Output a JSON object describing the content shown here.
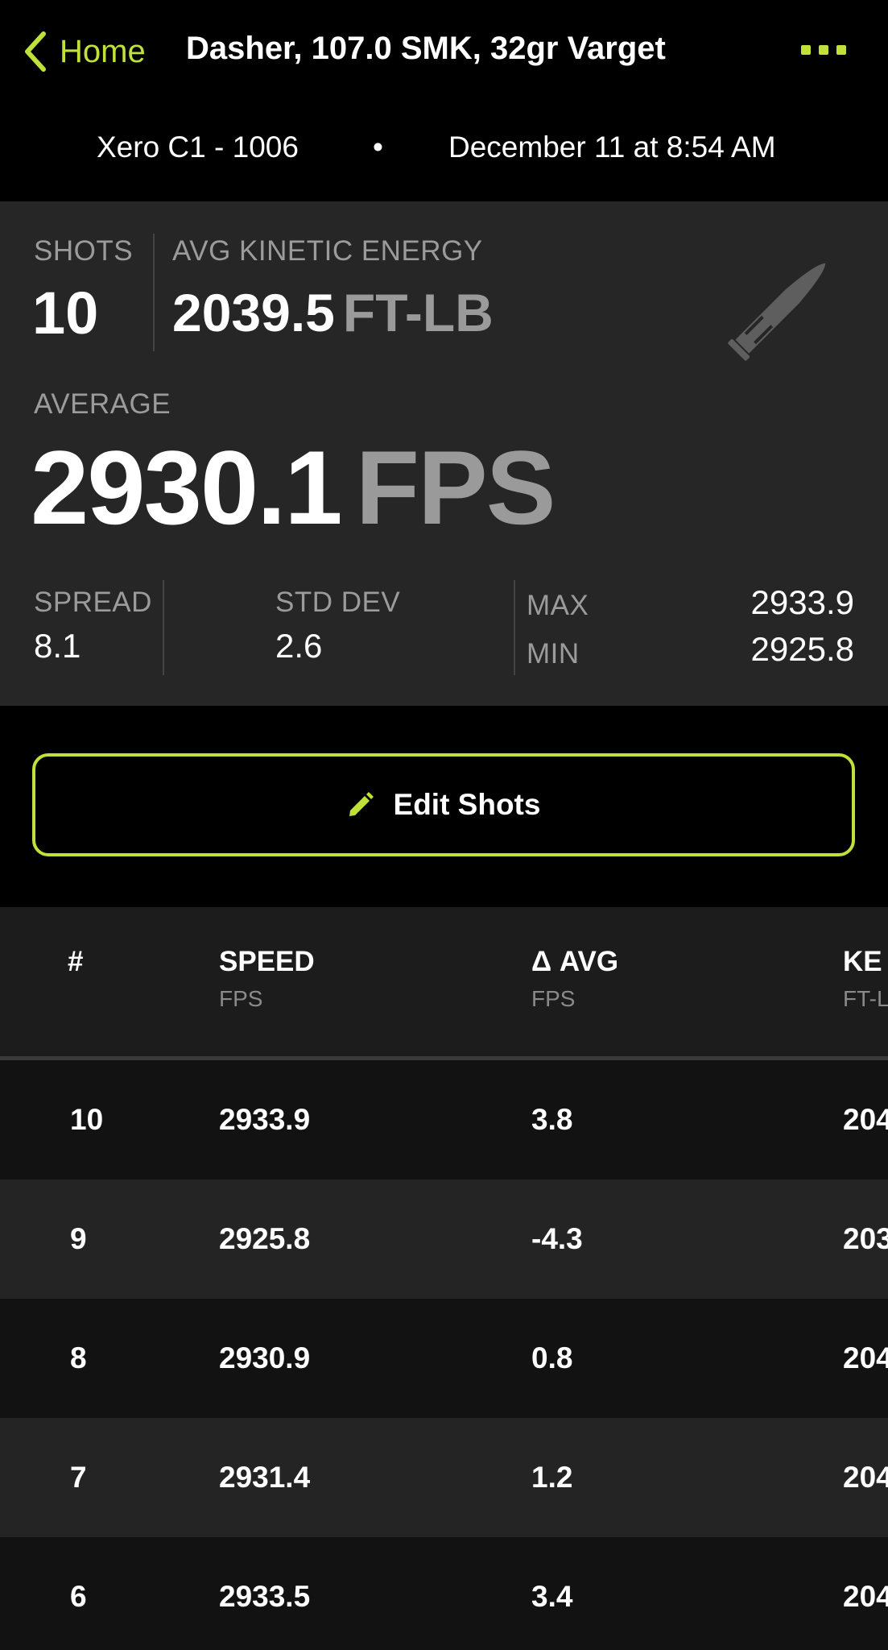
{
  "header": {
    "back_label": "Home",
    "title": "Dasher, 107.0 SMK, 32gr Varget",
    "device": "Xero C1 - 1006",
    "separator": "•",
    "date": "December 11 at 8:54 AM"
  },
  "summary": {
    "shots_label": "SHOTS",
    "shots_value": "10",
    "ke_label": "AVG KINETIC ENERGY",
    "ke_value": "2039.5",
    "ke_unit": "FT-LB",
    "avg_label": "AVERAGE",
    "avg_value": "2930.1",
    "avg_unit": "FPS",
    "spread_label": "SPREAD",
    "spread_value": "8.1",
    "sd_label": "STD DEV",
    "sd_value": "2.6",
    "max_label": "MAX",
    "max_value": "2933.9",
    "min_label": "MIN",
    "min_value": "2925.8"
  },
  "edit_button": {
    "label": "Edit Shots"
  },
  "table": {
    "columns": [
      {
        "title": "#",
        "unit": ""
      },
      {
        "title": "SPEED",
        "unit": "FPS"
      },
      {
        "title": "Δ AVG",
        "unit": "FPS"
      },
      {
        "title": "KE",
        "unit": "FT-L"
      }
    ],
    "rows": [
      {
        "num": "10",
        "speed": "2933.9",
        "delta": "3.8",
        "ke": "204"
      },
      {
        "num": "9",
        "speed": "2925.8",
        "delta": "-4.3",
        "ke": "203"
      },
      {
        "num": "8",
        "speed": "2930.9",
        "delta": "0.8",
        "ke": "204"
      },
      {
        "num": "7",
        "speed": "2931.4",
        "delta": "1.2",
        "ke": "204"
      },
      {
        "num": "6",
        "speed": "2933.5",
        "delta": "3.4",
        "ke": "204"
      }
    ]
  },
  "colors": {
    "accent": "#bfe13a",
    "panel": "#262626",
    "muted": "#9b9b9b"
  },
  "icons": {
    "back": "chevron-left-icon",
    "more": "more-dots-icon",
    "bullet": "bullet-icon",
    "pencil": "pencil-icon"
  }
}
